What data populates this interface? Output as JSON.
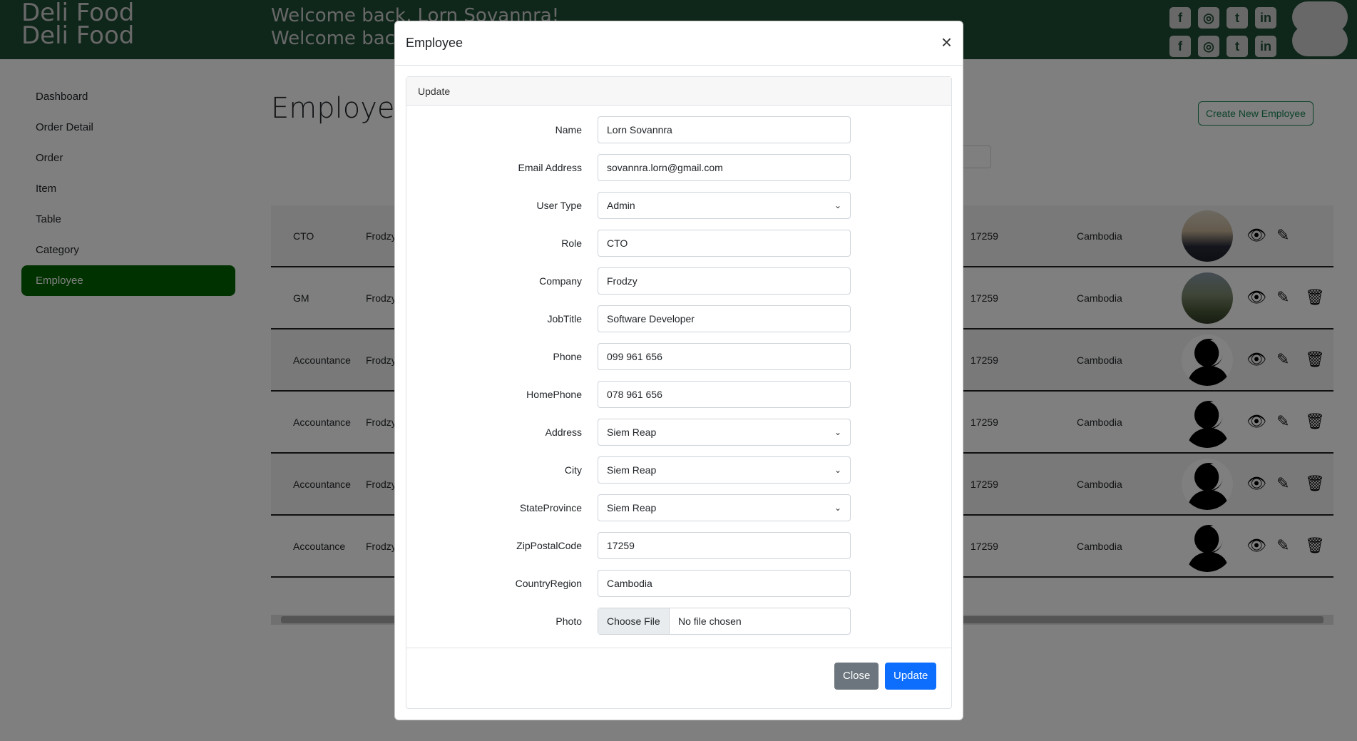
{
  "header": {
    "brand_line1": "Deli Food",
    "brand_line2": "Deli Food",
    "welcome_line1": "Welcome back, Lorn Sovannra!",
    "welcome_line2": "Welcome back, Lorn Sovannra!",
    "social_icons": [
      "facebook-icon",
      "instagram-icon",
      "twitter-icon",
      "linkedin-icon"
    ]
  },
  "sidebar": {
    "items": [
      {
        "label": "Dashboard"
      },
      {
        "label": "Order Detail"
      },
      {
        "label": "Order"
      },
      {
        "label": "Item"
      },
      {
        "label": "Table"
      },
      {
        "label": "Category"
      },
      {
        "label": "Employee",
        "active": true
      }
    ]
  },
  "main": {
    "title": "Employee",
    "create_button": "Create New Employee",
    "rows": [
      {
        "role": "CTO",
        "company": "Frodzy",
        "zip": "17259",
        "country": "Cambodia",
        "avatar": "photo1",
        "delete": false
      },
      {
        "role": "GM",
        "company": "Frodzy",
        "zip": "17259",
        "country": "Cambodia",
        "avatar": "photo2",
        "delete": true
      },
      {
        "role": "Accountance",
        "company": "Frodzy",
        "zip": "17259",
        "country": "Cambodia",
        "avatar": "silhouette",
        "delete": true
      },
      {
        "role": "Accountance",
        "company": "Frodzy",
        "zip": "17259",
        "country": "Cambodia",
        "avatar": "silhouette",
        "delete": true
      },
      {
        "role": "Accountance",
        "company": "Frodzy",
        "zip": "17259",
        "country": "Cambodia",
        "avatar": "silhouette",
        "delete": true
      },
      {
        "role": "Accoutance",
        "company": "Frodzy",
        "zip": "17259",
        "country": "Cambodia",
        "avatar": "silhouette",
        "delete": true
      }
    ]
  },
  "modal": {
    "title": "Employee",
    "card_header": "Update",
    "fields": {
      "name": {
        "label": "Name",
        "value": "Lorn Sovannra"
      },
      "email": {
        "label": "Email Address",
        "value": "sovannra.lorn@gmail.com"
      },
      "user_type": {
        "label": "User Type",
        "value": "Admin"
      },
      "role": {
        "label": "Role",
        "value": "CTO"
      },
      "company": {
        "label": "Company",
        "value": "Frodzy"
      },
      "jobtitle": {
        "label": "JobTitle",
        "value": "Software Developer"
      },
      "phone": {
        "label": "Phone",
        "value": "099 961 656"
      },
      "homephone": {
        "label": "HomePhone",
        "value": "078 961 656"
      },
      "address": {
        "label": "Address",
        "value": "Siem Reap"
      },
      "city": {
        "label": "City",
        "value": "Siem Reap"
      },
      "state": {
        "label": "StateProvince",
        "value": "Siem Reap"
      },
      "zip": {
        "label": "ZipPostalCode",
        "value": "17259"
      },
      "country": {
        "label": "CountryRegion",
        "value": "Cambodia"
      },
      "photo": {
        "label": "Photo",
        "button": "Choose File",
        "status": "No file chosen"
      }
    },
    "close_button": "Close",
    "update_button": "Update"
  }
}
